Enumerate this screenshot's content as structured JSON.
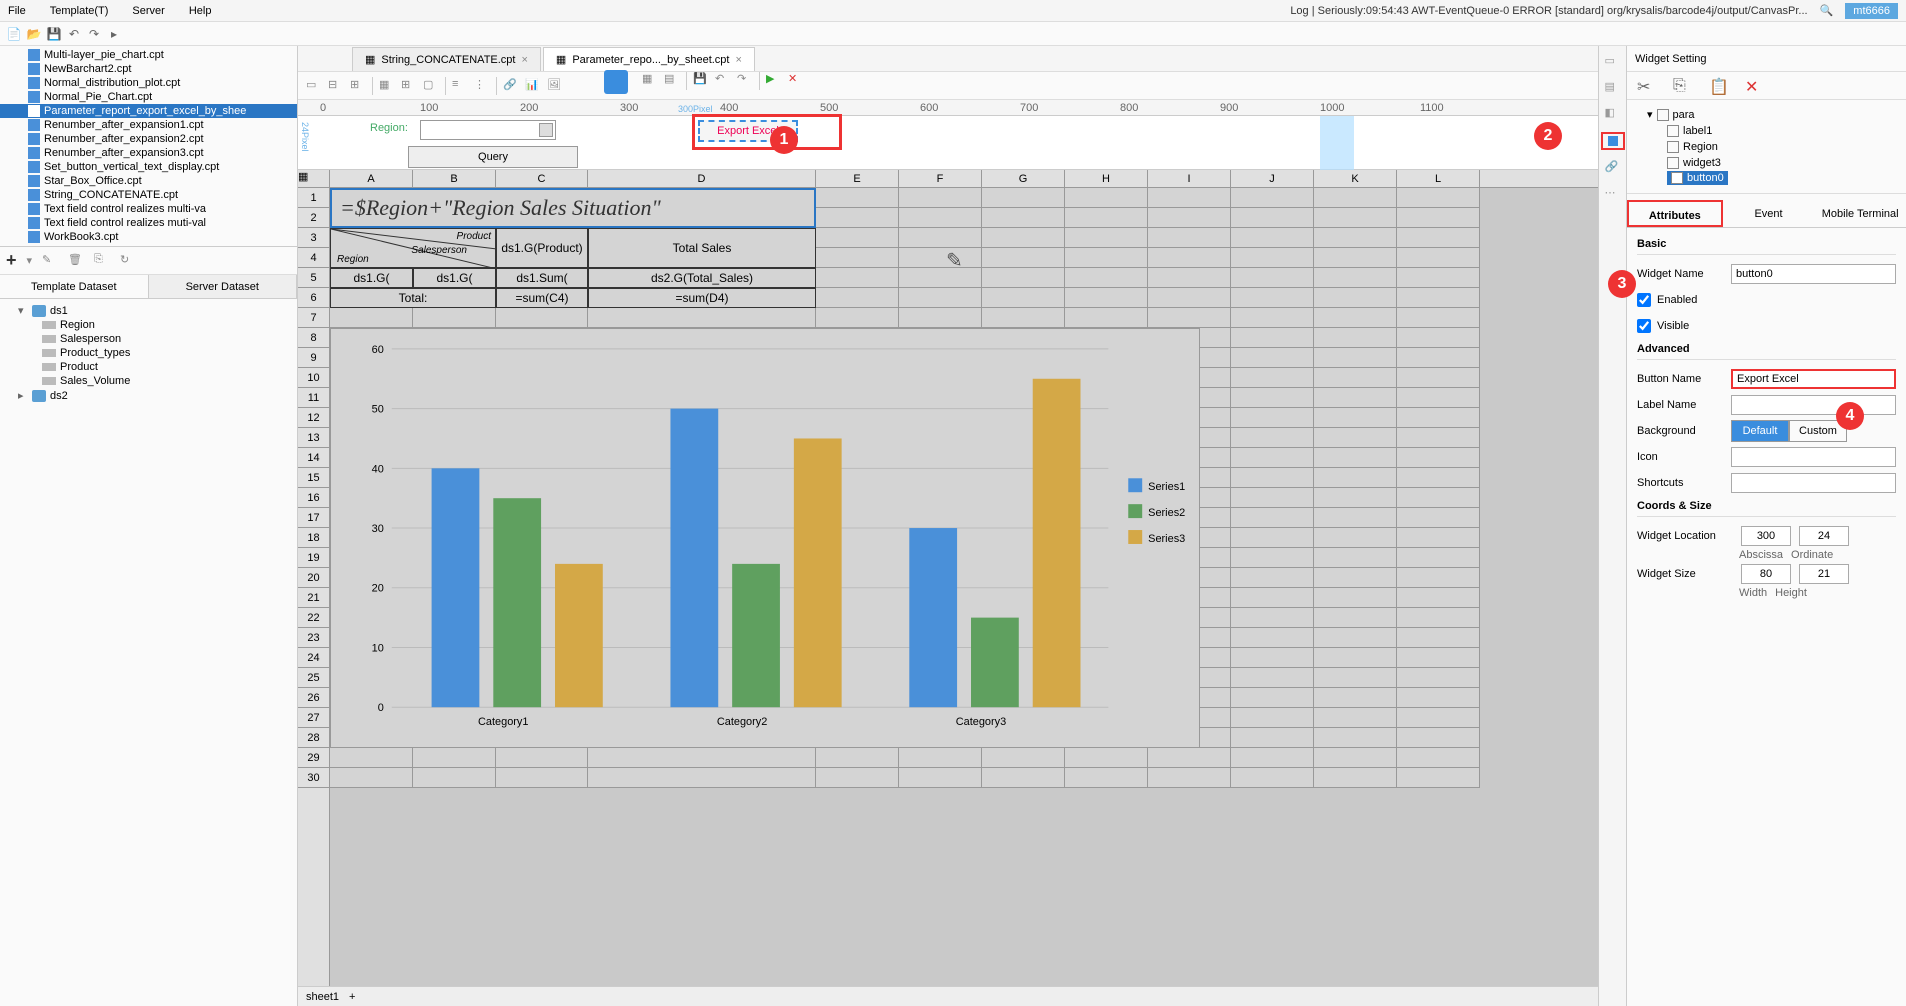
{
  "menu": {
    "items": [
      "File",
      "Template(T)",
      "Server",
      "Help"
    ],
    "log": "Log | Seriously:09:54:43 AWT-EventQueue-0 ERROR [standard] org/krysalis/barcode4j/output/CanvasPr...",
    "user": "mt6666"
  },
  "files": {
    "items": [
      "Multi-layer_pie_chart.cpt",
      "NewBarchart2.cpt",
      "Normal_distribution_plot.cpt",
      "Normal_Pie_Chart.cpt",
      "Parameter_report_export_excel_by_shee",
      "Renumber_after_expansion1.cpt",
      "Renumber_after_expansion2.cpt",
      "Renumber_after_expansion3.cpt",
      "Set_button_vertical_text_display.cpt",
      "Star_Box_Office.cpt",
      "String_CONCATENATE.cpt",
      "Text field control realizes multi-va",
      "Text field control realizes muti-val",
      "WorkBook3.cpt"
    ],
    "selected_index": 4
  },
  "ds_tabs": {
    "template": "Template Dataset",
    "server": "Server Dataset"
  },
  "datasets": {
    "ds1": {
      "name": "ds1",
      "cols": [
        "Region",
        "Salesperson",
        "Product_types",
        "Product",
        "Sales_Volume"
      ]
    },
    "ds2": {
      "name": "ds2"
    }
  },
  "doc_tabs": [
    {
      "label": "String_CONCATENATE.cpt",
      "active": false
    },
    {
      "label": "Parameter_repo..._by_sheet.cpt",
      "active": true
    }
  ],
  "param": {
    "region_label": "Region:",
    "export_label": "Export Excel",
    "query_label": "Query",
    "ruler": [
      "0",
      "100",
      "200",
      "300",
      "400",
      "500",
      "600",
      "700",
      "800",
      "900",
      "1000",
      "1100"
    ],
    "pixel300": "300Pixel",
    "pixel24": "24Pixel"
  },
  "sheet": {
    "cols": [
      "A",
      "B",
      "C",
      "D",
      "E",
      "F",
      "G",
      "H",
      "I",
      "J",
      "K",
      "L"
    ],
    "rows_count": 30,
    "title": "=$Region+\"Region Sales Situation\"",
    "r3": {
      "product": "Product",
      "region": "Region",
      "sales": "Salesperson",
      "c": "ds1.G(Product)",
      "d": "Total Sales"
    },
    "r4": {
      "a": "ds1.G(",
      "b": "ds1.G(",
      "c": "ds1.Sum(",
      "d": "ds2.G(Total_Sales)"
    },
    "r5": {
      "ab": "Total:",
      "c": "=sum(C4)",
      "d": "=sum(D4)"
    }
  },
  "chart_data": {
    "type": "bar",
    "categories": [
      "Category1",
      "Category2",
      "Category3"
    ],
    "series": [
      {
        "name": "Series1",
        "color": "#4a90d9",
        "values": [
          40,
          50,
          30
        ]
      },
      {
        "name": "Series2",
        "color": "#5fa05f",
        "values": [
          35,
          24,
          15
        ]
      },
      {
        "name": "Series3",
        "color": "#d4a847",
        "values": [
          24,
          45,
          55
        ]
      }
    ],
    "ylim": [
      0,
      60
    ],
    "yticks": [
      0,
      10,
      20,
      30,
      40,
      50,
      60
    ]
  },
  "widget": {
    "panel_title": "Widget Setting",
    "tree": {
      "root": "para",
      "items": [
        "label1",
        "Region",
        "widget3",
        "button0"
      ],
      "selected": "button0"
    },
    "tabs": [
      "Attributes",
      "Event",
      "Mobile Terminal"
    ],
    "basic": "Basic",
    "advanced": "Advanced",
    "coords": "Coords & Size",
    "name_label": "Widget Name",
    "name_value": "button0",
    "enabled": "Enabled",
    "visible": "Visible",
    "btn_name_label": "Button Name",
    "btn_name_value": "Export Excel",
    "label_name": "Label Name",
    "background": "Background",
    "bg_default": "Default",
    "bg_custom": "Custom",
    "icon": "Icon",
    "shortcuts": "Shortcuts",
    "loc_label": "Widget Location",
    "loc_x": "300",
    "loc_y": "24",
    "abscissa": "Abscissa",
    "ordinate": "Ordinate",
    "size_label": "Widget Size",
    "size_w": "80",
    "size_h": "21",
    "width": "Width",
    "height": "Height"
  },
  "annotations": {
    "1": "1",
    "2": "2",
    "3": "3",
    "4": "4"
  },
  "status": {
    "sheet": "sheet1"
  }
}
